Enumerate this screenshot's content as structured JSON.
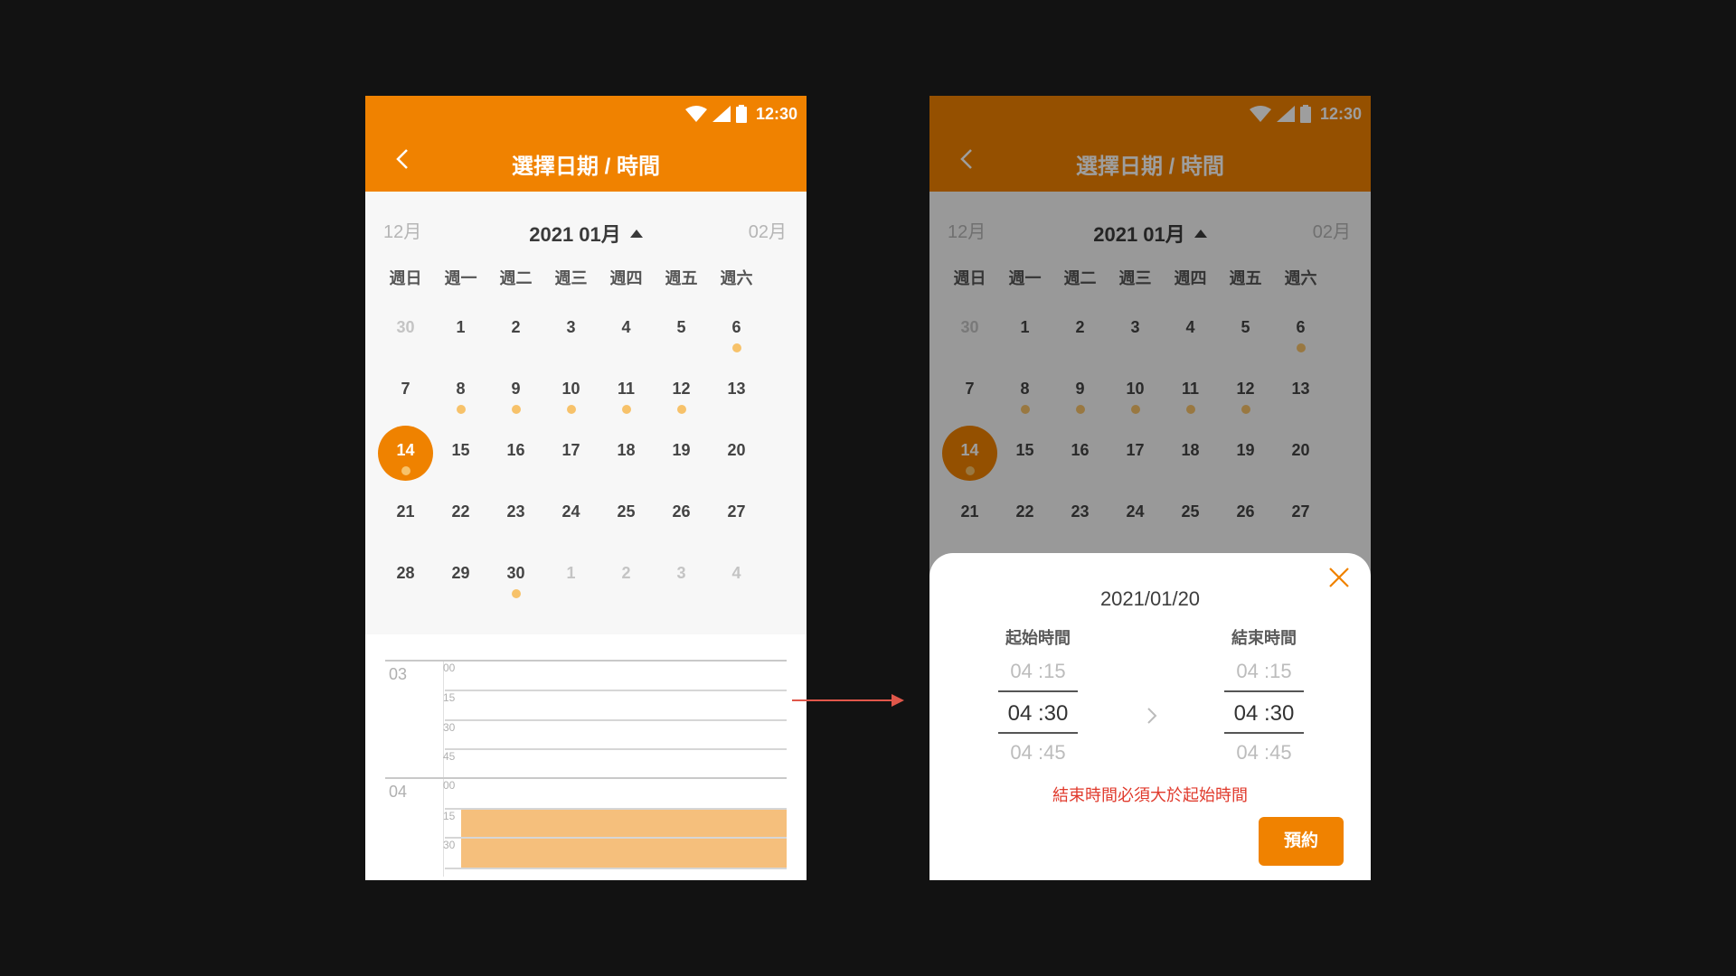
{
  "status_bar": {
    "time": "12:30"
  },
  "header": {
    "title": "選擇日期 / 時間"
  },
  "calendar": {
    "prev_month": "12月",
    "current_month": "2021 01月",
    "next_month": "02月",
    "weekdays": [
      "週日",
      "週一",
      "週二",
      "週三",
      "週四",
      "週五",
      "週六"
    ],
    "weeks": [
      [
        "30",
        "1",
        "2",
        "3",
        "4",
        "5",
        "6"
      ],
      [
        "7",
        "8",
        "9",
        "10",
        "11",
        "12",
        "13"
      ],
      [
        "14",
        "15",
        "16",
        "17",
        "18",
        "19",
        "20"
      ],
      [
        "21",
        "22",
        "23",
        "24",
        "25",
        "26",
        "27"
      ],
      [
        "28",
        "29",
        "30",
        "1",
        "2",
        "3",
        "4"
      ]
    ],
    "selected_day": "14",
    "days_with_bookings": [
      "6",
      "8",
      "9",
      "10",
      "11",
      "12",
      "14",
      "30"
    ]
  },
  "timeline": {
    "hours": [
      "03",
      "04"
    ],
    "quarters": [
      "00",
      "15",
      "30",
      "45"
    ],
    "booked_range": "04:15–04:45"
  },
  "sheet": {
    "date": "2021/01/20",
    "start_label": "起始時間",
    "end_label": "結束時間",
    "start_times": [
      "04 :15",
      "04 :30",
      "04 :45"
    ],
    "end_times": [
      "04 :15",
      "04 :30",
      "04 :45"
    ],
    "error": "結束時間必須大於起始時間",
    "book_button": "預約"
  },
  "colors": {
    "accent": "#f08200",
    "booking_dot": "#f7c26a",
    "booked_block": "#f5bf7c",
    "error": "#e03a2c"
  }
}
